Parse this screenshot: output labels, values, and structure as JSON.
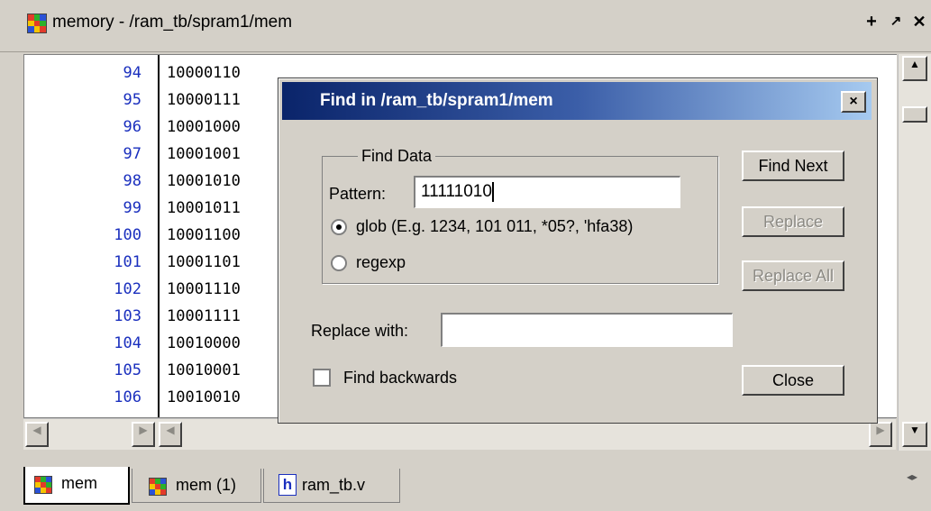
{
  "window": {
    "title": "memory - /ram_tb/spram1/mem",
    "controls": {
      "add": "+",
      "undock": "↗",
      "close": "✕"
    }
  },
  "memory": {
    "rows": [
      {
        "addr": "94",
        "value": "10000110"
      },
      {
        "addr": "95",
        "value": "10000111"
      },
      {
        "addr": "96",
        "value": "10001000"
      },
      {
        "addr": "97",
        "value": "10001001"
      },
      {
        "addr": "98",
        "value": "10001010"
      },
      {
        "addr": "99",
        "value": "10001011"
      },
      {
        "addr": "100",
        "value": "10001100"
      },
      {
        "addr": "101",
        "value": "10001101"
      },
      {
        "addr": "102",
        "value": "10001110"
      },
      {
        "addr": "103",
        "value": "10001111"
      },
      {
        "addr": "104",
        "value": "10010000"
      },
      {
        "addr": "105",
        "value": "10010001"
      },
      {
        "addr": "106",
        "value": "10010010"
      }
    ]
  },
  "dialog": {
    "title": "Find in /ram_tb/spram1/mem",
    "close": "×",
    "group_label": "Find Data",
    "pattern_label": "Pattern:",
    "pattern_value": "11111010",
    "glob_label": "glob (E.g. 1234, 101 011, *05?, 'hfa38)",
    "regexp_label": "regexp",
    "replace_label": "Replace with:",
    "replace_value": "",
    "backwards_label": "Find backwards",
    "find_next": "Find Next",
    "replace": "Replace",
    "replace_all": "Replace All",
    "close_button": "Close"
  },
  "tabs": [
    {
      "label": "mem",
      "icon": "memory-grid-icon"
    },
    {
      "label": "mem (1)",
      "icon": "memory-grid-icon"
    },
    {
      "label": "ram_tb.v",
      "icon": "verilog-file-icon",
      "icon_glyph": "h"
    }
  ],
  "colors": {
    "address_blue": "#1a2fbe",
    "dialog_title_start": "#0a246a",
    "dialog_title_end": "#a6caf0"
  }
}
